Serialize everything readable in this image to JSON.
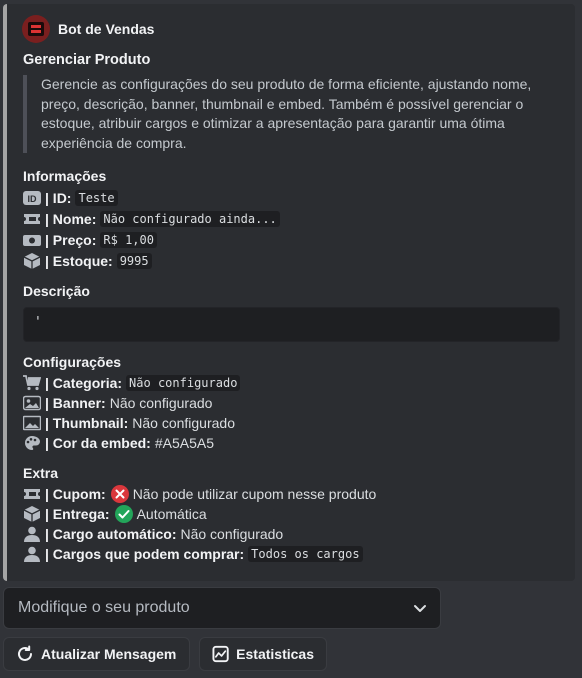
{
  "embed": {
    "accent_color": "#A5A5A5",
    "author": {
      "name": "Bot de Vendas",
      "avatar": "bot-avatar"
    },
    "title": "Gerenciar Produto",
    "description": "Gerencie as configurações do seu produto de forma eficiente, ajustando nome, preço, descrição, banner, thumbnail e embed. Também é possível gerenciar o estoque, atribuir cargos e otimizar a apresentação para garantir uma ótima experiência de compra.",
    "info": {
      "title": "Informações",
      "id": {
        "icon": "id-icon",
        "label": "| ID:",
        "value": "Teste"
      },
      "name": {
        "icon": "ticket-icon",
        "label": "| Nome:",
        "value": "Não configurado ainda..."
      },
      "price": {
        "icon": "money-icon",
        "label": "| Preço:",
        "value": "R$ 1,00"
      },
      "stock": {
        "icon": "package-icon",
        "label": "| Estoque:",
        "value": "9995"
      }
    },
    "description_field": {
      "title": "Descrição",
      "value": "'"
    },
    "config": {
      "title": "Configurações",
      "category": {
        "icon": "cart-icon",
        "label": "| Categoria:",
        "value": "Não configurado"
      },
      "banner": {
        "icon": "image-icon",
        "label": "| Banner:",
        "value": "Não configurado"
      },
      "thumbnail": {
        "icon": "picture-icon",
        "label": "| Thumbnail:",
        "value": "Não configurado"
      },
      "color": {
        "icon": "palette-icon",
        "label": "| Cor da embed:",
        "value": "#A5A5A5"
      }
    },
    "extra": {
      "title": "Extra",
      "coupon": {
        "icon": "ticket-icon",
        "label": "| Cupom:",
        "status_icon": "cross-mark-icon",
        "value": "Não pode utilizar cupom nesse produto"
      },
      "delivery": {
        "icon": "package-icon",
        "label": "| Entrega:",
        "status_icon": "check-mark-icon",
        "value": "Automática"
      },
      "auto_role": {
        "icon": "person-icon",
        "label": "| Cargo automático:",
        "value": "Não configurado"
      },
      "buy_roles": {
        "icon": "person-icon",
        "label": "| Cargos que podem comprar:",
        "value": "Todos os cargos"
      }
    }
  },
  "select": {
    "placeholder": "Modifique o seu produto",
    "icon": "chevron-down-icon"
  },
  "buttons": {
    "refresh": {
      "label": "Atualizar Mensagem",
      "icon": "refresh-icon"
    },
    "stats": {
      "label": "Estatisticas",
      "icon": "chart-icon"
    }
  }
}
